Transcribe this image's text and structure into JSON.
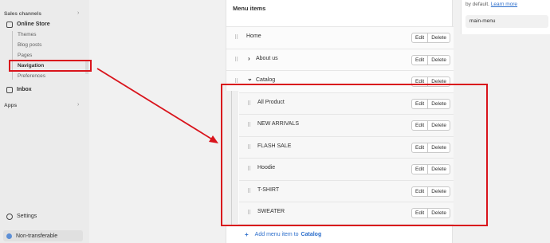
{
  "sidebar": {
    "sales_channels_label": "Sales channels",
    "online_store_label": "Online Store",
    "sub_items": [
      "Themes",
      "Blog posts",
      "Pages",
      "Navigation",
      "Preferences"
    ],
    "inbox_label": "Inbox",
    "apps_label": "Apps",
    "settings_label": "Settings",
    "plan_badge": "Non-transferable"
  },
  "right_panel": {
    "text": "by default.",
    "link": "Learn more",
    "handle_value": "main-menu"
  },
  "menu": {
    "title": "Menu items",
    "edit_label": "Edit",
    "delete_label": "Delete",
    "items": [
      {
        "label": "Home",
        "chevron": ""
      },
      {
        "label": "About us",
        "chevron": "›"
      },
      {
        "label": "Catalog",
        "chevron": "⌄"
      }
    ],
    "children": [
      "All Product",
      "NEW ARRIVALS",
      "FLASH SALE",
      "Hoodie",
      "T-SHIRT",
      "SWEATER"
    ],
    "add_prefix": "Add menu item to",
    "add_target": "Catalog"
  },
  "colors": {
    "highlight": "#d9141c",
    "link": "#2c6ecb"
  }
}
